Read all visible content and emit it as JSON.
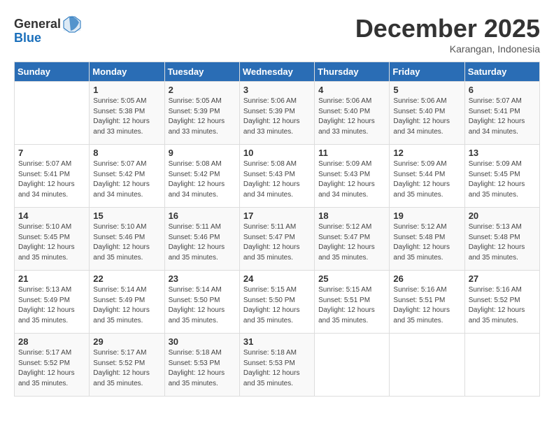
{
  "header": {
    "logo_general": "General",
    "logo_blue": "Blue",
    "month": "December 2025",
    "location": "Karangan, Indonesia"
  },
  "weekdays": [
    "Sunday",
    "Monday",
    "Tuesday",
    "Wednesday",
    "Thursday",
    "Friday",
    "Saturday"
  ],
  "weeks": [
    [
      {
        "day": "",
        "info": ""
      },
      {
        "day": "1",
        "info": "Sunrise: 5:05 AM\nSunset: 5:38 PM\nDaylight: 12 hours\nand 33 minutes."
      },
      {
        "day": "2",
        "info": "Sunrise: 5:05 AM\nSunset: 5:39 PM\nDaylight: 12 hours\nand 33 minutes."
      },
      {
        "day": "3",
        "info": "Sunrise: 5:06 AM\nSunset: 5:39 PM\nDaylight: 12 hours\nand 33 minutes."
      },
      {
        "day": "4",
        "info": "Sunrise: 5:06 AM\nSunset: 5:40 PM\nDaylight: 12 hours\nand 33 minutes."
      },
      {
        "day": "5",
        "info": "Sunrise: 5:06 AM\nSunset: 5:40 PM\nDaylight: 12 hours\nand 34 minutes."
      },
      {
        "day": "6",
        "info": "Sunrise: 5:07 AM\nSunset: 5:41 PM\nDaylight: 12 hours\nand 34 minutes."
      }
    ],
    [
      {
        "day": "7",
        "info": "Sunrise: 5:07 AM\nSunset: 5:41 PM\nDaylight: 12 hours\nand 34 minutes."
      },
      {
        "day": "8",
        "info": "Sunrise: 5:07 AM\nSunset: 5:42 PM\nDaylight: 12 hours\nand 34 minutes."
      },
      {
        "day": "9",
        "info": "Sunrise: 5:08 AM\nSunset: 5:42 PM\nDaylight: 12 hours\nand 34 minutes."
      },
      {
        "day": "10",
        "info": "Sunrise: 5:08 AM\nSunset: 5:43 PM\nDaylight: 12 hours\nand 34 minutes."
      },
      {
        "day": "11",
        "info": "Sunrise: 5:09 AM\nSunset: 5:43 PM\nDaylight: 12 hours\nand 34 minutes."
      },
      {
        "day": "12",
        "info": "Sunrise: 5:09 AM\nSunset: 5:44 PM\nDaylight: 12 hours\nand 35 minutes."
      },
      {
        "day": "13",
        "info": "Sunrise: 5:09 AM\nSunset: 5:45 PM\nDaylight: 12 hours\nand 35 minutes."
      }
    ],
    [
      {
        "day": "14",
        "info": "Sunrise: 5:10 AM\nSunset: 5:45 PM\nDaylight: 12 hours\nand 35 minutes."
      },
      {
        "day": "15",
        "info": "Sunrise: 5:10 AM\nSunset: 5:46 PM\nDaylight: 12 hours\nand 35 minutes."
      },
      {
        "day": "16",
        "info": "Sunrise: 5:11 AM\nSunset: 5:46 PM\nDaylight: 12 hours\nand 35 minutes."
      },
      {
        "day": "17",
        "info": "Sunrise: 5:11 AM\nSunset: 5:47 PM\nDaylight: 12 hours\nand 35 minutes."
      },
      {
        "day": "18",
        "info": "Sunrise: 5:12 AM\nSunset: 5:47 PM\nDaylight: 12 hours\nand 35 minutes."
      },
      {
        "day": "19",
        "info": "Sunrise: 5:12 AM\nSunset: 5:48 PM\nDaylight: 12 hours\nand 35 minutes."
      },
      {
        "day": "20",
        "info": "Sunrise: 5:13 AM\nSunset: 5:48 PM\nDaylight: 12 hours\nand 35 minutes."
      }
    ],
    [
      {
        "day": "21",
        "info": "Sunrise: 5:13 AM\nSunset: 5:49 PM\nDaylight: 12 hours\nand 35 minutes."
      },
      {
        "day": "22",
        "info": "Sunrise: 5:14 AM\nSunset: 5:49 PM\nDaylight: 12 hours\nand 35 minutes."
      },
      {
        "day": "23",
        "info": "Sunrise: 5:14 AM\nSunset: 5:50 PM\nDaylight: 12 hours\nand 35 minutes."
      },
      {
        "day": "24",
        "info": "Sunrise: 5:15 AM\nSunset: 5:50 PM\nDaylight: 12 hours\nand 35 minutes."
      },
      {
        "day": "25",
        "info": "Sunrise: 5:15 AM\nSunset: 5:51 PM\nDaylight: 12 hours\nand 35 minutes."
      },
      {
        "day": "26",
        "info": "Sunrise: 5:16 AM\nSunset: 5:51 PM\nDaylight: 12 hours\nand 35 minutes."
      },
      {
        "day": "27",
        "info": "Sunrise: 5:16 AM\nSunset: 5:52 PM\nDaylight: 12 hours\nand 35 minutes."
      }
    ],
    [
      {
        "day": "28",
        "info": "Sunrise: 5:17 AM\nSunset: 5:52 PM\nDaylight: 12 hours\nand 35 minutes."
      },
      {
        "day": "29",
        "info": "Sunrise: 5:17 AM\nSunset: 5:52 PM\nDaylight: 12 hours\nand 35 minutes."
      },
      {
        "day": "30",
        "info": "Sunrise: 5:18 AM\nSunset: 5:53 PM\nDaylight: 12 hours\nand 35 minutes."
      },
      {
        "day": "31",
        "info": "Sunrise: 5:18 AM\nSunset: 5:53 PM\nDaylight: 12 hours\nand 35 minutes."
      },
      {
        "day": "",
        "info": ""
      },
      {
        "day": "",
        "info": ""
      },
      {
        "day": "",
        "info": ""
      }
    ]
  ]
}
